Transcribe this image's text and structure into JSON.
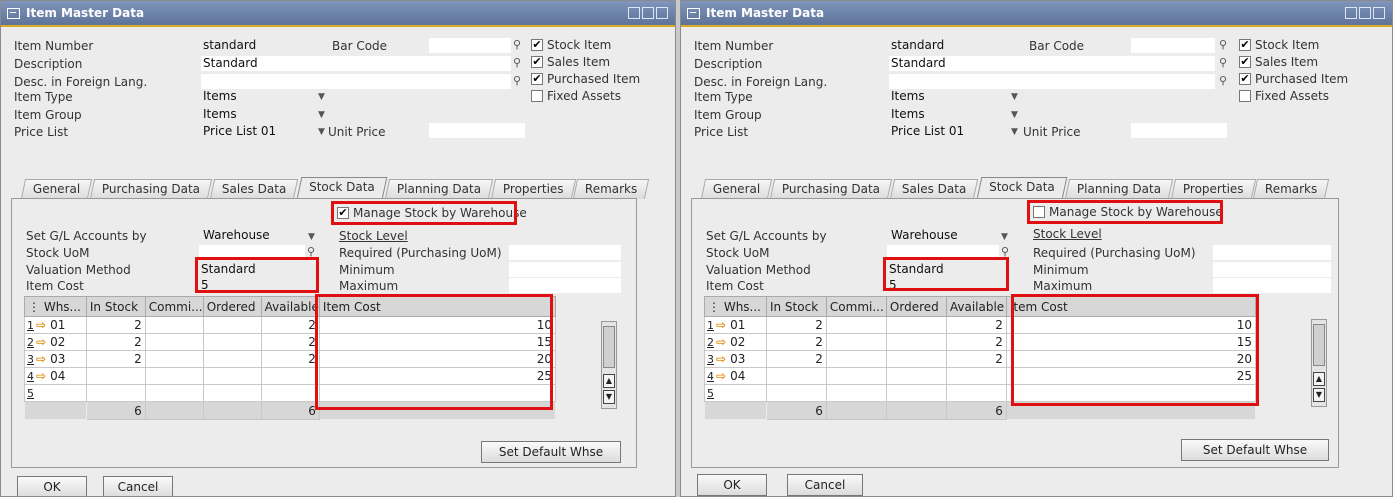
{
  "window_title": "Item Master Data",
  "header": {
    "item_number_label": "Item Number",
    "item_number": "standard",
    "description_label": "Description",
    "description": "Standard",
    "foreign_lang_label": "Desc. in Foreign Lang.",
    "item_type_label": "Item Type",
    "item_type": "Items",
    "item_group_label": "Item Group",
    "item_group": "Items",
    "price_list_label": "Price List",
    "price_list": "Price List 01",
    "unit_price_label": "Unit Price",
    "bar_code_label": "Bar Code",
    "stock_item_label": "Stock Item",
    "sales_item_label": "Sales Item",
    "purchased_item_label": "Purchased Item",
    "fixed_assets_label": "Fixed Assets"
  },
  "tabs": [
    "General",
    "Purchasing Data",
    "Sales Data",
    "Stock Data",
    "Planning Data",
    "Properties",
    "Remarks"
  ],
  "stock": {
    "manage_label": "Manage Stock by Warehouse",
    "gl_label": "Set G/L Accounts by",
    "gl_value": "Warehouse",
    "uom_label": "Stock UoM",
    "valuation_label": "Valuation Method",
    "valuation_value": "Standard",
    "item_cost_label": "Item Cost",
    "item_cost_value": "5",
    "stock_level_label": "Stock Level",
    "required_label": "Required (Purchasing UoM)",
    "minimum_label": "Minimum",
    "maximum_label": "Maximum"
  },
  "grid": {
    "columns": [
      "Whs...",
      "In Stock",
      "Commi...",
      "Ordered",
      "Available",
      "Item Cost"
    ],
    "corner": "⋮",
    "rows": [
      {
        "n": "1",
        "whs": "01",
        "in_stock": "2",
        "available": "2",
        "cost": "10"
      },
      {
        "n": "2",
        "whs": "02",
        "in_stock": "2",
        "available": "2",
        "cost": "15"
      },
      {
        "n": "3",
        "whs": "03",
        "in_stock": "2",
        "available": "2",
        "cost": "20"
      },
      {
        "n": "4",
        "whs": "04",
        "in_stock": "",
        "available": "",
        "cost": "25"
      },
      {
        "n": "5",
        "whs": "",
        "in_stock": "",
        "available": "",
        "cost": ""
      }
    ],
    "total_in_stock": "6",
    "total_available": "6"
  },
  "buttons": {
    "set_default": "Set Default Whse",
    "ok": "OK",
    "cancel": "Cancel"
  },
  "left_manage_checked": "✔",
  "right_manage_checked": "",
  "check_mark": "✔",
  "highlight_color": "#e01010"
}
